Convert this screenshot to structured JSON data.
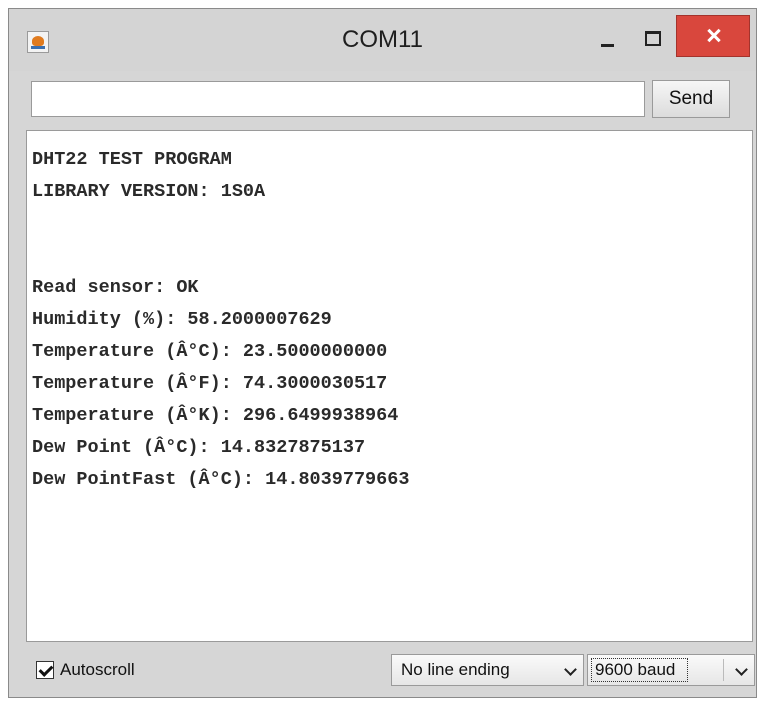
{
  "window": {
    "title": "COM11"
  },
  "input": {
    "value": "",
    "send_label": "Send"
  },
  "output": {
    "lines": [
      "DHT22 TEST PROGRAM",
      "LIBRARY VERSION: 1S0A",
      "",
      "",
      "Read sensor: OK",
      "Humidity (%): 58.2000007629",
      "Temperature (Â°C): 23.5000000000",
      "Temperature (Â°F): 74.3000030517",
      "Temperature (Â°K): 296.6499938964",
      "Dew Point (Â°C): 14.8327875137",
      "Dew PointFast (Â°C): 14.8039779663"
    ]
  },
  "statusbar": {
    "autoscroll_label": "Autoscroll",
    "autoscroll_checked": true,
    "line_ending": "No line ending",
    "baud": "9600 baud"
  },
  "colors": {
    "close_button": "#d9473d",
    "titlebar": "#d4d4d4"
  }
}
